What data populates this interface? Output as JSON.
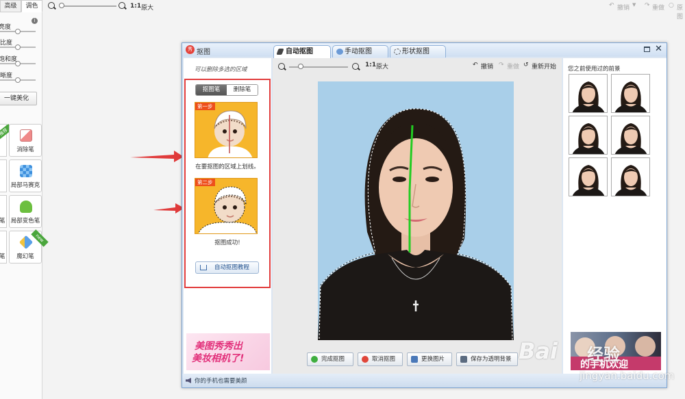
{
  "base_panel": {
    "tabs": [
      "高级",
      "调色"
    ],
    "sliders": [
      {
        "label": "亮度",
        "value": 0.5
      },
      {
        "label": "对比度",
        "value": 0.5
      },
      {
        "label": "色彩饱和度",
        "value": 0.5
      },
      {
        "label": "清晰度",
        "value": 0.5
      }
    ],
    "beautify_label": "一键美化",
    "tools": [
      {
        "label": "消除笔",
        "badge": "推荐"
      },
      {
        "label": "局部马赛克",
        "badge": ""
      },
      {
        "label": "局部变色笔",
        "badge": ""
      },
      {
        "label": "魔幻笔",
        "badge": "new"
      }
    ],
    "cut_tool_labels": [
      "笔",
      "笔"
    ]
  },
  "top_toolbar": {
    "ratio": "1:1",
    "original_label": "原大",
    "undo_label": "撤销",
    "redo_label": "重做",
    "reset_label": "原图"
  },
  "dialog": {
    "title": "抠图",
    "tabs": [
      {
        "label": "自动抠图",
        "active": true
      },
      {
        "label": "手动抠图",
        "active": false
      },
      {
        "label": "形状抠图",
        "active": false
      }
    ],
    "side": {
      "hint": "可以删除多选的区域",
      "pen_tabs": [
        {
          "label": "抠图笔",
          "active": true
        },
        {
          "label": "删除笔",
          "active": false
        }
      ],
      "step1": {
        "tag": "第一步",
        "caption": "在要抠图的区域上划线。"
      },
      "step2": {
        "tag": "第二步",
        "caption": "抠图成功!"
      },
      "tutorial_label": "自动抠图教程",
      "promo_line1": "美图秀秀出",
      "promo_line2": "美妆相机了!"
    },
    "canvas": {
      "ratio": "1:1",
      "original_label": "原大",
      "undo_label": "撤销",
      "redo_label": "重做",
      "restart_label": "重新开始",
      "slider_value": 0.2,
      "buttons": [
        "完成抠图",
        "取消抠图",
        "更换图片",
        "保存为透明背景"
      ]
    },
    "right": {
      "title": "您之前使用过的前景",
      "thumb_count": 6
    },
    "status_text": "你的手机也需要美颜"
  },
  "watermark": {
    "logo": "Bai",
    "logo_cn": "经验",
    "url": "jingyan.baidu.com",
    "banner": "的手机欢迎"
  },
  "colors": {
    "highlight_box": "#e13c3c",
    "arrow": "#e03a3a",
    "stroke": "#22cc22",
    "photo_bg": "#a9cfe9"
  }
}
